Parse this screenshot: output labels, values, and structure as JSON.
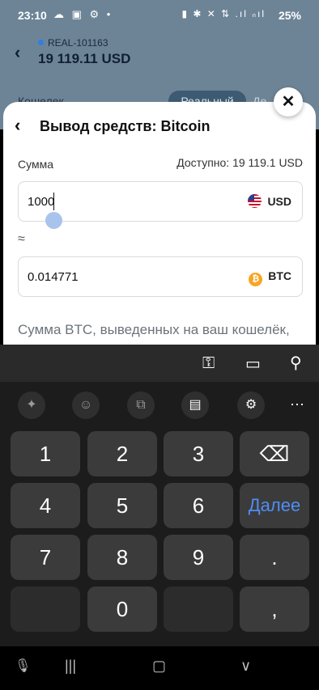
{
  "status": {
    "time": "23:10",
    "left_icons": "☁ ▣ ⚙ •",
    "right_icons": "▮ ✱ ✕ ⇅ .ıl ₙıl",
    "battery": "25%"
  },
  "account": {
    "id": "REAL-101163",
    "balance": "19 119.11 USD",
    "wallet_label": "Кошелек",
    "seg_real": "Реальный",
    "seg_demo": "Де"
  },
  "sheet": {
    "title": "Вывод средств: Bitcoin",
    "amount_label": "Сумма",
    "available": "Доступно: 19 119.1 USD",
    "usd_value": "1000",
    "usd_currency": "USD",
    "approx_symbol": "≈",
    "btc_value": "0.014771",
    "btc_currency": "BTC",
    "note": "Сумма BTC, выведенных на ваш кошелёк, BTC"
  },
  "keyboard": {
    "keys": [
      "1",
      "2",
      "3",
      "4",
      "5",
      "6",
      "7",
      "8",
      "9",
      "0",
      ".",
      ","
    ],
    "next_label": "Далее",
    "backspace": "⌫"
  },
  "icons": {
    "key": "key-icon",
    "card": "card-icon",
    "location": "location-icon",
    "sparkle": "sparkle-icon",
    "emoji": "emoji-icon",
    "translate": "translate-icon",
    "clipboard": "clipboard-icon",
    "settings": "gear-icon"
  }
}
